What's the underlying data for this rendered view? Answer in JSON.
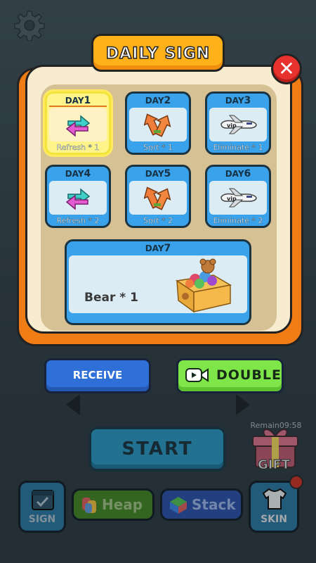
{
  "dialog": {
    "title": "DAILY SIGN",
    "close_icon": "close-icon",
    "days": [
      {
        "day_prefix": "DAY",
        "day_num": "1",
        "reward": "Refresh * 1",
        "icon": "refresh-icon",
        "selected": true
      },
      {
        "day_prefix": "DAY",
        "day_num": "2",
        "reward": "Sort * 1",
        "icon": "sort-icon",
        "selected": false
      },
      {
        "day_prefix": "DAY",
        "day_num": "3",
        "reward": "Eliminate * 1",
        "icon": "vip-plane-icon",
        "selected": false
      },
      {
        "day_prefix": "DAY",
        "day_num": "4",
        "reward": "Refresh * 2",
        "icon": "refresh-icon",
        "selected": false
      },
      {
        "day_prefix": "DAY",
        "day_num": "5",
        "reward": "Sort * 2",
        "icon": "sort-icon",
        "selected": false
      },
      {
        "day_prefix": "DAY",
        "day_num": "6",
        "reward": "Eliminate * 2",
        "icon": "vip-plane-icon",
        "selected": false
      }
    ],
    "day7": {
      "day_prefix": "DAY",
      "day_num": "7",
      "reward": "Bear * 1",
      "icon": "bear-box-icon"
    },
    "plane_badge": "vip",
    "receive_label": "RECEIVE",
    "double_label": "DOUBLE"
  },
  "game": {
    "start_label": "START",
    "gift_remain": "Remain09:58",
    "gift_label": "GIFT",
    "tabs": {
      "sign": "SIGN",
      "heap": "Heap",
      "stack": "Stack",
      "skin": "SKIN"
    }
  },
  "colors": {
    "dialog_orange": "#f07c16",
    "title_yellow": "#ffb11a",
    "card_blue": "#3aa2ea",
    "receive_blue": "#2f6fd8",
    "double_green": "#7fe64a",
    "close_red": "#e8322e"
  }
}
